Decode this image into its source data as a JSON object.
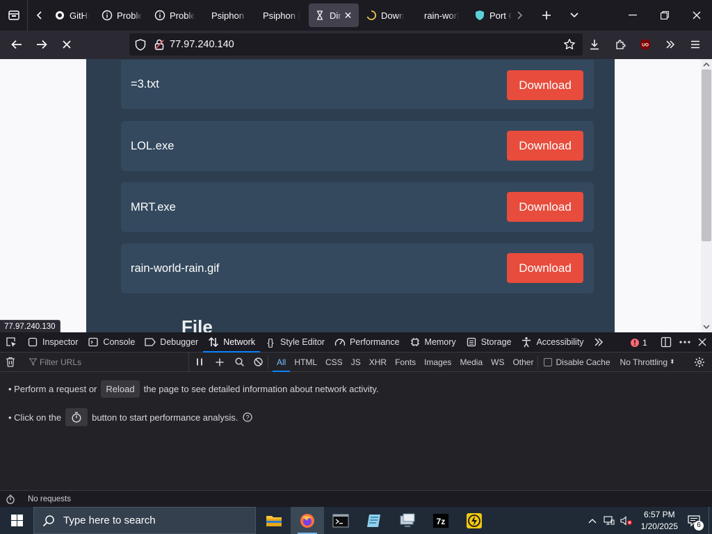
{
  "browser": {
    "tabs": [
      {
        "label": "GitHub",
        "icon": "github-icon",
        "active": false
      },
      {
        "label": "Problem",
        "icon": "info-icon",
        "active": false
      },
      {
        "label": "Problem",
        "icon": "info-icon",
        "active": false
      },
      {
        "label": "Psiphon -",
        "icon": "none",
        "active": false
      },
      {
        "label": "Psiphon |",
        "icon": "none",
        "active": false
      },
      {
        "label": "Dir",
        "icon": "hourglass-icon",
        "active": true
      },
      {
        "label": "Down",
        "icon": "loading-icon",
        "active": false
      },
      {
        "label": "rain-worl",
        "icon": "none",
        "active": false
      },
      {
        "label": "Port C",
        "icon": "shield-icon",
        "active": false
      }
    ],
    "url": "77.97.240.140",
    "status_url": "77.97.240.130"
  },
  "page": {
    "files": [
      {
        "name": "=3.txt",
        "button": "Download"
      },
      {
        "name": "LOL.exe",
        "button": "Download"
      },
      {
        "name": "MRT.exe",
        "button": "Download"
      },
      {
        "name": "rain-world-rain.gif",
        "button": "Download"
      }
    ],
    "section_heading_partial": "File",
    "colors": {
      "panel": "#2c3e50",
      "row": "#34495e",
      "button": "#e74c3c"
    }
  },
  "devtools": {
    "tools": [
      "Inspector",
      "Console",
      "Debugger",
      "Network",
      "Style Editor",
      "Performance",
      "Memory",
      "Storage",
      "Accessibility"
    ],
    "active_tool": "Network",
    "error_count": "1",
    "filter_placeholder": "Filter URLs",
    "filters": [
      "All",
      "HTML",
      "CSS",
      "JS",
      "XHR",
      "Fonts",
      "Images",
      "Media",
      "WS",
      "Other"
    ],
    "active_filter": "All",
    "disable_cache": "Disable Cache",
    "throttling": "No Throttling",
    "line1_pre": "• Perform a request or",
    "reload": "Reload",
    "line1_post": "the page to see detailed information about network activity.",
    "line2_pre": "• Click on the",
    "line2_post": "button to start performance analysis.",
    "status": "No requests"
  },
  "taskbar": {
    "search_placeholder": "Type here to search",
    "time": "6:57 PM",
    "date": "1/20/2025",
    "notification_count": "6"
  }
}
